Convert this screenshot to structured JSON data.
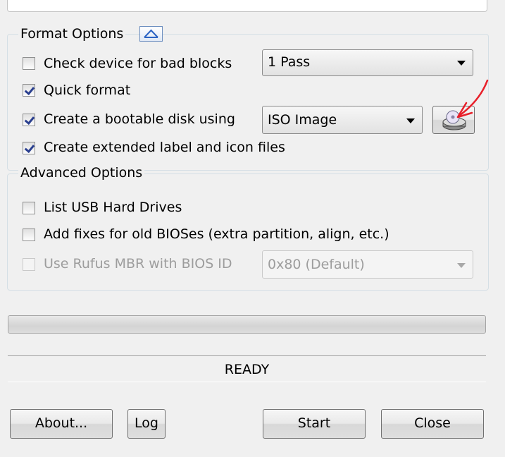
{
  "format_options": {
    "title": "Format Options",
    "bad_blocks": {
      "label": "Check device for bad blocks",
      "checked": false,
      "passes": "1 Pass"
    },
    "quick_format": {
      "label": "Quick format",
      "checked": true
    },
    "bootable": {
      "label": "Create a bootable disk using",
      "checked": true,
      "type": "ISO Image"
    },
    "extended_label": {
      "label": "Create extended label and icon files",
      "checked": true
    }
  },
  "advanced_options": {
    "title": "Advanced Options",
    "list_usb": {
      "label": "List USB Hard Drives",
      "checked": false
    },
    "old_bios": {
      "label": "Add fixes for old BIOSes (extra partition, align, etc.)",
      "checked": false
    },
    "rufus_mbr": {
      "label": "Use Rufus MBR with BIOS ID",
      "checked": false,
      "disabled": true,
      "bios_id": "0x80 (Default)"
    }
  },
  "progress": {
    "value": 0
  },
  "status": {
    "text": "READY"
  },
  "buttons": {
    "about": "About...",
    "log": "Log",
    "start": "Start",
    "close": "Close"
  },
  "colors": {
    "background": "#f0f0f0",
    "group_border": "#d5dfe5",
    "annotation": "#e8202a",
    "checkmark": "#2a3f8f"
  },
  "icons": {
    "collapse": "chevron-up-icon",
    "select_image": "disc-drive-icon",
    "annotation": "red-arrow-annotation"
  }
}
